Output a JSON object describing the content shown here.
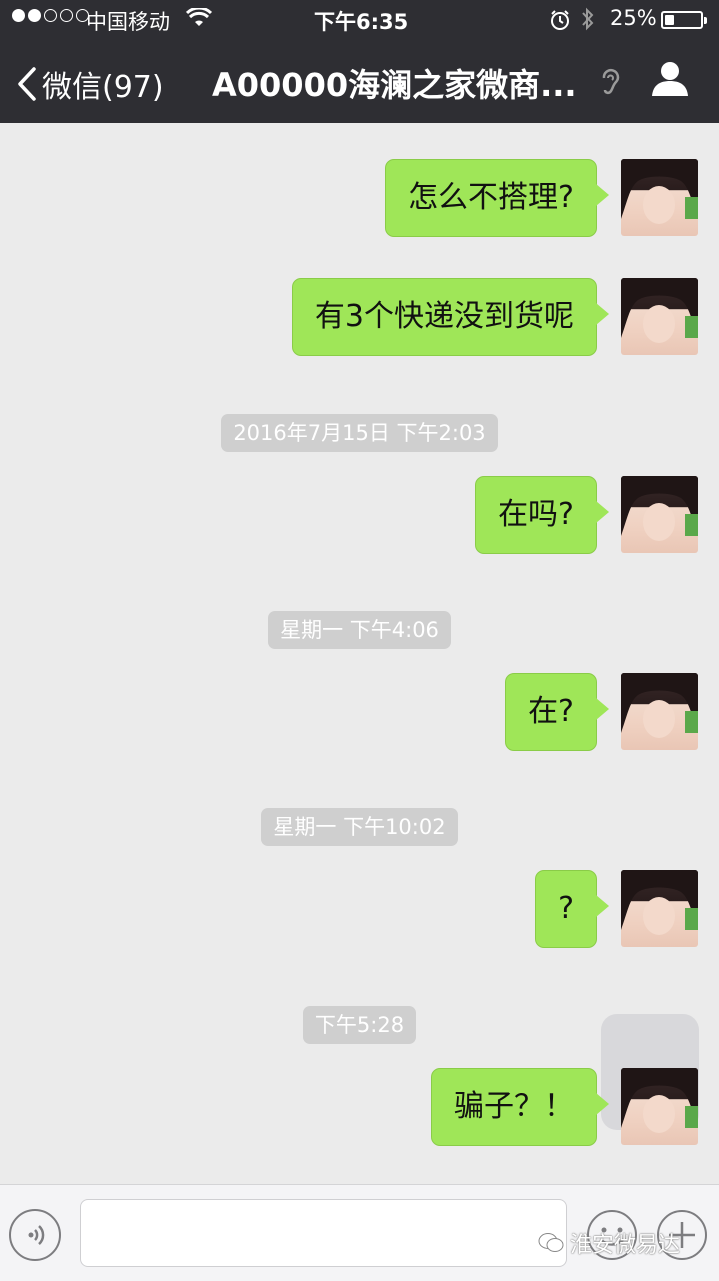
{
  "status_bar": {
    "carrier": "中国移动",
    "time": "下午6:35",
    "battery": "25%",
    "battery_level": 0.25
  },
  "nav": {
    "back_label": "微信(97)",
    "title": "A00000海澜之家微商..."
  },
  "messages": [
    {
      "type": "sent",
      "text": "怎么不搭理?"
    },
    {
      "type": "sent",
      "text": "有3个快递没到货呢"
    },
    {
      "type": "time",
      "text": "2016年7月15日 下午2:03"
    },
    {
      "type": "sent",
      "text": "在吗?"
    },
    {
      "type": "time",
      "text": "星期一 下午4:06"
    },
    {
      "type": "sent",
      "text": "在?"
    },
    {
      "type": "time",
      "text": "星期一 下午10:02"
    },
    {
      "type": "sent",
      "text": "?"
    },
    {
      "type": "time",
      "text": "下午5:28"
    },
    {
      "type": "sent",
      "text": "骗子？！"
    }
  ],
  "watermark": "淮安微易达",
  "colors": {
    "bubble": "#9fe658",
    "background": "#ebebeb",
    "navbar": "#2e2e33",
    "timestamp_bg": "#cfcfcf"
  }
}
